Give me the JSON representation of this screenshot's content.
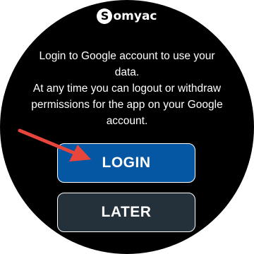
{
  "app": {
    "logo_letter": "S",
    "logo_text": "omyac"
  },
  "message": {
    "line1": "Login to Google account to use your",
    "line2": "data.",
    "line3": "At any time you can logout or withdraw",
    "line4": "permissions for the app on your Google",
    "line5": "account."
  },
  "buttons": {
    "login_label": "LOGIN",
    "later_label": "LATER"
  },
  "colors": {
    "login_bg": "#0557a3",
    "later_bg": "#24303a",
    "arrow": "#e8453c"
  },
  "icons": {
    "annotation_arrow": "arrow-pointer-icon"
  }
}
